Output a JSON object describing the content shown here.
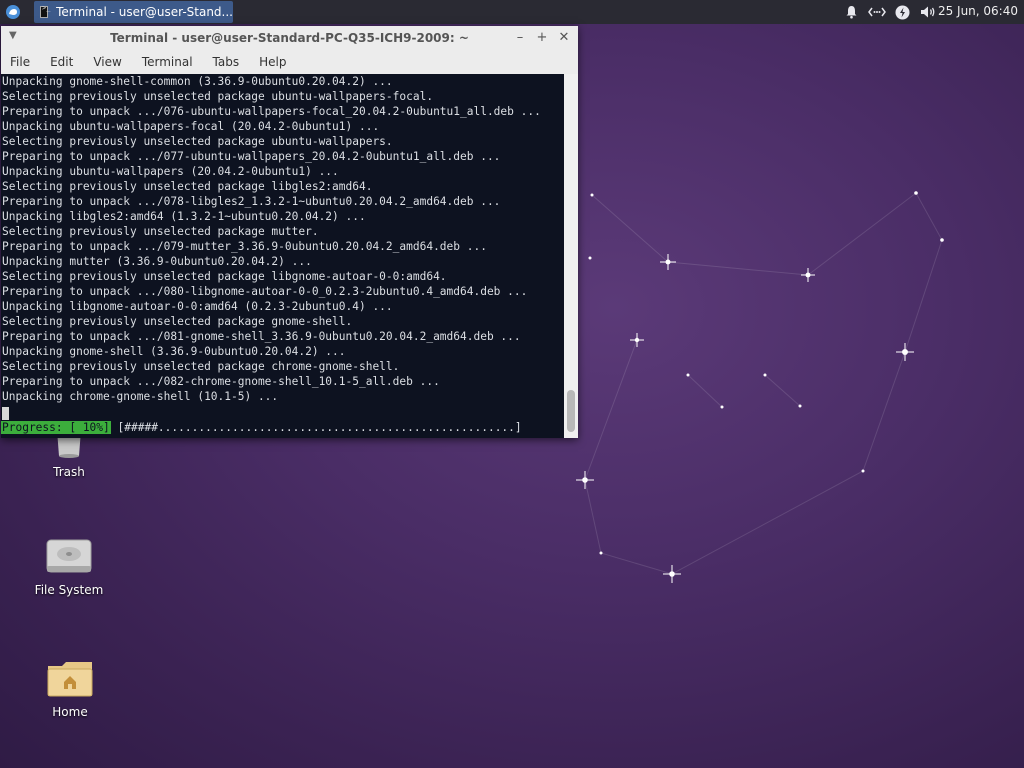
{
  "panel": {
    "task_title": "Terminal - user@user-Stand...",
    "clock": "25 Jun, 06:40",
    "tray_icons": [
      "bell-icon",
      "network-icon",
      "power-icon",
      "volume-icon"
    ]
  },
  "desktop": {
    "icons": [
      {
        "label": "Trash",
        "icon": "trash-icon"
      },
      {
        "label": "File System",
        "icon": "drive-icon"
      },
      {
        "label": "Home",
        "icon": "home-folder-icon"
      }
    ]
  },
  "window": {
    "title": "Terminal - user@user-Standard-PC-Q35-ICH9-2009: ~",
    "menu": [
      "File",
      "Edit",
      "View",
      "Terminal",
      "Tabs",
      "Help"
    ],
    "lines": [
      "Unpacking gnome-shell-common (3.36.9-0ubuntu0.20.04.2) ...",
      "Selecting previously unselected package ubuntu-wallpapers-focal.",
      "Preparing to unpack .../076-ubuntu-wallpapers-focal_20.04.2-0ubuntu1_all.deb ...",
      "Unpacking ubuntu-wallpapers-focal (20.04.2-0ubuntu1) ...",
      "Selecting previously unselected package ubuntu-wallpapers.",
      "Preparing to unpack .../077-ubuntu-wallpapers_20.04.2-0ubuntu1_all.deb ...",
      "Unpacking ubuntu-wallpapers (20.04.2-0ubuntu1) ...",
      "Selecting previously unselected package libgles2:amd64.",
      "Preparing to unpack .../078-libgles2_1.3.2-1~ubuntu0.20.04.2_amd64.deb ...",
      "Unpacking libgles2:amd64 (1.3.2-1~ubuntu0.20.04.2) ...",
      "Selecting previously unselected package mutter.",
      "Preparing to unpack .../079-mutter_3.36.9-0ubuntu0.20.04.2_amd64.deb ...",
      "Unpacking mutter (3.36.9-0ubuntu0.20.04.2) ...",
      "Selecting previously unselected package libgnome-autoar-0-0:amd64.",
      "Preparing to unpack .../080-libgnome-autoar-0-0_0.2.3-2ubuntu0.4_amd64.deb ...",
      "Unpacking libgnome-autoar-0-0:amd64 (0.2.3-2ubuntu0.4) ...",
      "Selecting previously unselected package gnome-shell.",
      "Preparing to unpack .../081-gnome-shell_3.36.9-0ubuntu0.20.04.2_amd64.deb ...",
      "Unpacking gnome-shell (3.36.9-0ubuntu0.20.04.2) ...",
      "Selecting previously unselected package chrome-gnome-shell.",
      "Preparing to unpack .../082-chrome-gnome-shell_10.1-5_all.deb ...",
      "Unpacking chrome-gnome-shell (10.1-5) ..."
    ],
    "progress_label": "Progress: [ 10%]",
    "progress_bar": " [#####.....................................................] ",
    "progress_fraction": 0.1
  }
}
